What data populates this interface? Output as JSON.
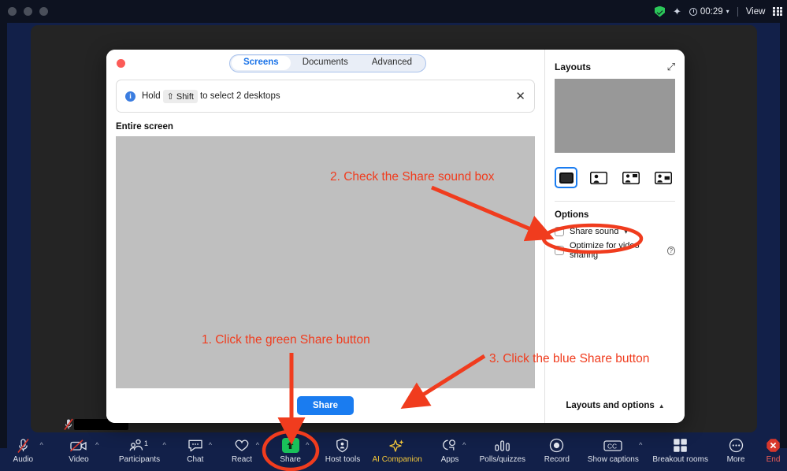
{
  "menubar": {
    "shield_icon": "shield-check-icon",
    "ai_icon": "ai-sparkle-icon",
    "timer_label": "00:29",
    "timer_caret": "⌄",
    "view_label": "View",
    "grid_icon": "grid-view-icon"
  },
  "dialog": {
    "close_dot": "close-window-dot",
    "tabs": [
      {
        "label": "Screens",
        "active": true
      },
      {
        "label": "Documents",
        "active": false
      },
      {
        "label": "Advanced",
        "active": false
      }
    ],
    "banner": {
      "info_glyph": "i",
      "text_before": "Hold",
      "kbd": "⇧ Shift",
      "text_after": "to select 2 desktops",
      "close_glyph": "✕"
    },
    "screen_label": "Entire screen",
    "share_button": "Share"
  },
  "panel": {
    "title": "Layouts",
    "expand_icon": "expand-diagonal-icon",
    "layout_options": [
      {
        "name": "layout-full-screen",
        "selected": true
      },
      {
        "name": "layout-screen-with-speaker",
        "selected": false
      },
      {
        "name": "layout-screen-with-thumbnails",
        "selected": false
      },
      {
        "name": "layout-side-by-side",
        "selected": false
      }
    ],
    "options_title": "Options",
    "options": [
      {
        "label": "Share sound",
        "checked": false,
        "has_caret": true,
        "has_help": false
      },
      {
        "label": "Optimize for video sharing",
        "checked": false,
        "has_caret": false,
        "has_help": true
      }
    ],
    "footer_label": "Layouts and options",
    "footer_caret": "▲"
  },
  "toolbar": {
    "items": [
      {
        "label": "Audio",
        "icon": "microphone-muted-icon",
        "caret": true,
        "badge": ""
      },
      {
        "label": "Video",
        "icon": "camera-muted-icon",
        "caret": true,
        "badge": ""
      },
      {
        "label": "Participants",
        "icon": "participants-icon",
        "caret": true,
        "badge": "1"
      },
      {
        "label": "Chat",
        "icon": "chat-bubble-icon",
        "caret": true,
        "badge": ""
      },
      {
        "label": "React",
        "icon": "heart-icon",
        "caret": true,
        "badge": ""
      },
      {
        "label": "Share",
        "icon": "share-screen-icon",
        "caret": true,
        "badge": ""
      },
      {
        "label": "Host tools",
        "icon": "shield-icon",
        "caret": false,
        "badge": ""
      },
      {
        "label": "AI Companion",
        "icon": "ai-sparkle-icon",
        "caret": false,
        "badge": ""
      },
      {
        "label": "Apps",
        "icon": "apps-icon",
        "caret": true,
        "badge": ""
      },
      {
        "label": "Polls/quizzes",
        "icon": "poll-bars-icon",
        "caret": false,
        "badge": ""
      },
      {
        "label": "Record",
        "icon": "record-circle-icon",
        "caret": false,
        "badge": ""
      },
      {
        "label": "Show captions",
        "icon": "closed-captions-icon",
        "caret": true,
        "badge": ""
      },
      {
        "label": "Breakout rooms",
        "icon": "breakout-rooms-icon",
        "caret": false,
        "badge": ""
      },
      {
        "label": "More",
        "icon": "more-ellipsis-icon",
        "caret": false,
        "badge": ""
      },
      {
        "label": "End",
        "icon": "end-meeting-icon",
        "caret": false,
        "badge": ""
      }
    ]
  },
  "annotations": [
    {
      "name": "annotation-step-1",
      "text": "1. Click the green Share button"
    },
    {
      "name": "annotation-step-2",
      "text": "2. Check the Share sound box"
    },
    {
      "name": "annotation-step-3",
      "text": "3. Click the blue Share button"
    }
  ],
  "colors": {
    "annotation_red": "#f03c1e",
    "share_green": "#19c05a",
    "share_blue": "#1a7cf0",
    "tab_active_blue": "#1a73e8",
    "zoom_navy": "#122049"
  }
}
